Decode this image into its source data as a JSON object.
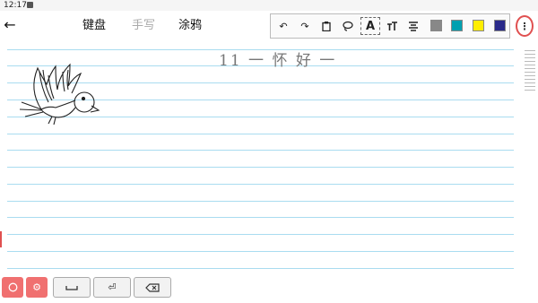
{
  "status": {
    "time": "12:17"
  },
  "header": {
    "back_icon": "arrow-left-icon",
    "modes": {
      "keyboard": "键盘",
      "handwriting": "手写",
      "doodle": "涂鸦"
    }
  },
  "toolbar": {
    "text_tool": "A",
    "colors": {
      "gray": "#888888",
      "teal": "#00a0b0",
      "yellow": "#ffee00",
      "navy": "#2a2a8a"
    }
  },
  "canvas": {
    "handwriting_text": "11 一 怀 好 一"
  },
  "accent_color": "#e05050"
}
